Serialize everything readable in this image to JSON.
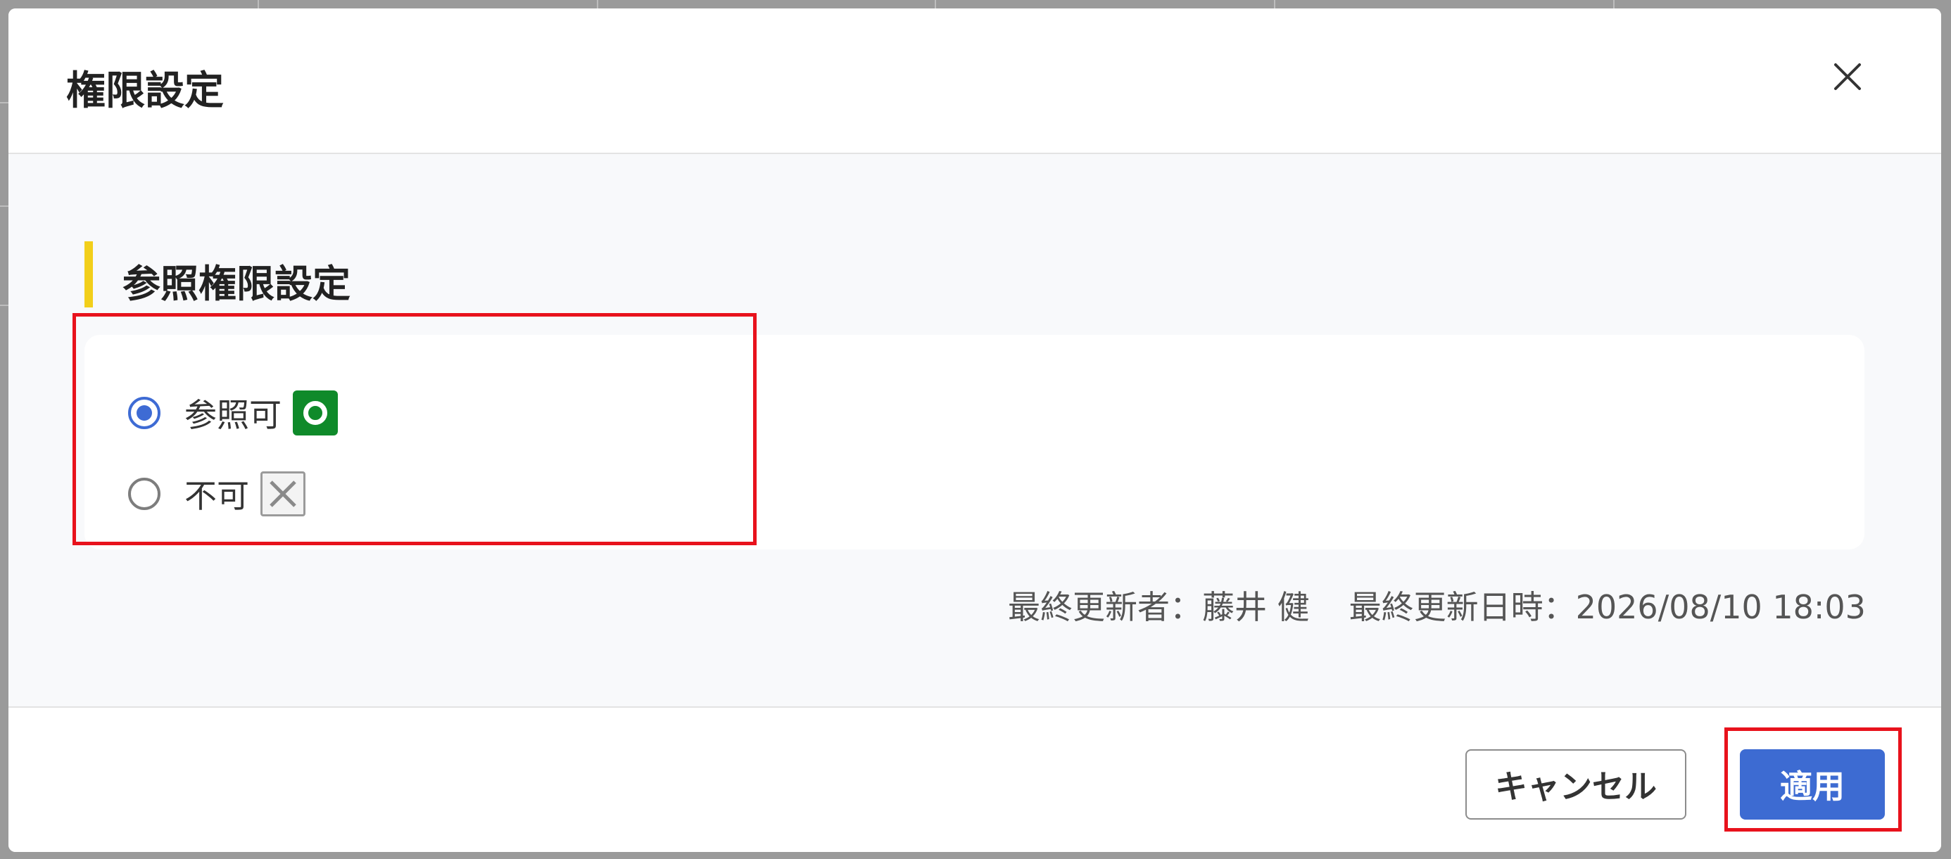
{
  "dialog": {
    "title": "権限設定",
    "close_icon": "close-icon"
  },
  "section": {
    "heading": "参照権限設定",
    "accent_color": "#f2cf1a"
  },
  "options": [
    {
      "label": "参照可",
      "checked": true,
      "icon": "ok-circle-icon",
      "icon_color": "#0f8a2a"
    },
    {
      "label": "不可",
      "checked": false,
      "icon": "ng-x-icon"
    }
  ],
  "meta": {
    "updated_by": "最終更新者：藤井 健",
    "updated_at": "最終更新日時：2026/08/10 18:03"
  },
  "footer": {
    "cancel_label": "キャンセル",
    "apply_label": "適用",
    "primary_color": "#3d6bd2"
  },
  "highlight_color": "#e8121c"
}
